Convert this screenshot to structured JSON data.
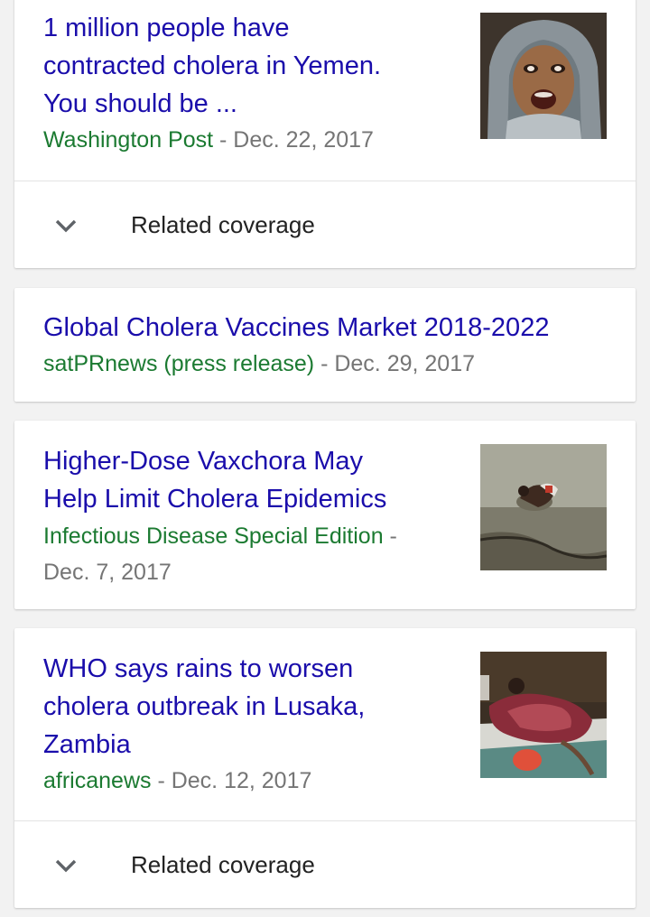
{
  "cards": [
    {
      "title": "1 million people have contracted cholera in Yemen. You should be ...",
      "title_lines": [
        "1 million people have",
        "contracted cholera in Yemen.",
        "You should be ..."
      ],
      "source": "Washington Post",
      "separator": " - ",
      "date": "Dec. 22, 2017",
      "related_label": "Related coverage"
    },
    {
      "title": "Global Cholera Vaccines Market 2018-2022",
      "source": "satPRnews (press release)",
      "separator": " - ",
      "date": "Dec. 29, 2017"
    },
    {
      "title_lines": [
        "Higher-Dose Vaxchora May",
        "Help Limit Cholera Epidemics"
      ],
      "source": "Infectious Disease Special Edition",
      "separator": " -",
      "date": "Dec. 7, 2017"
    },
    {
      "title_lines": [
        "WHO says rains to worsen",
        "cholera outbreak in Lusaka,",
        "Zambia"
      ],
      "source": "africanews",
      "separator": " - ",
      "date": "Dec. 12, 2017",
      "related_label": "Related coverage"
    }
  ],
  "icons": {
    "expand": "chevron-down-icon"
  },
  "colors": {
    "title": "#1a0dab",
    "source": "#1b7a31",
    "date": "#757575"
  }
}
